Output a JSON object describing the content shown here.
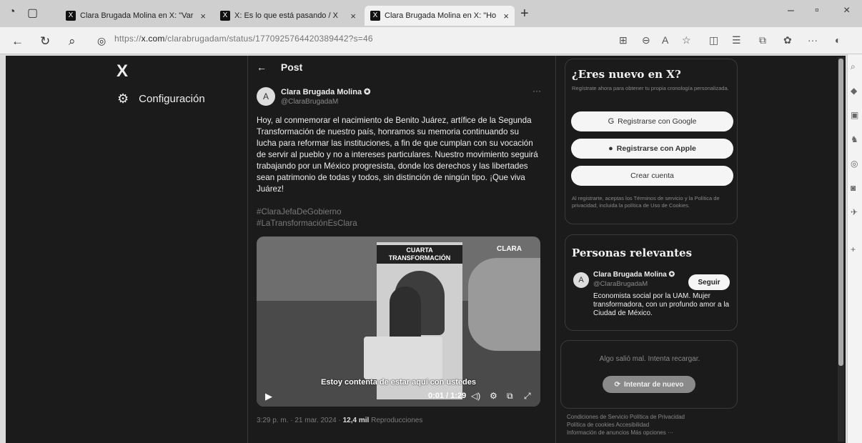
{
  "tabs": [
    {
      "label": "Clara Brugada Molina en X: \"Var",
      "active": false
    },
    {
      "label": "X: Es lo que está pasando / X",
      "active": false
    },
    {
      "label": "Clara Brugada Molina en X: \"Ho",
      "active": true
    }
  ],
  "address": {
    "prefix": "https://",
    "domain": "x.com",
    "path": "/clarabrugadam/status/1770925764420389442?s=46"
  },
  "x_nav": {
    "logo": "X",
    "config_label": "Configuración"
  },
  "post": {
    "header": "Post",
    "author_name": "Clara Brugada Molina",
    "author_handle": "@ClaraBrugadaM",
    "avatar_initial": "A",
    "text": "Hoy, al conmemorar el nacimiento de Benito Juárez, artífice de la Segunda Transformación de nuestro país, honramos su memoria continuando su lucha para reformar las instituciones, a fin de que cumplan con su vocación de servir al pueblo y no a intereses particulares. Nuestro movimiento seguirá trabajando por un México progresista, donde los derechos y las libertades sean patrimonio de todas y todos, sin distinción de ningún tipo. ¡Que viva Juárez!",
    "hashtag1": "#ClaraJefaDeGobierno",
    "hashtag2": "#LaTransformaciónEsClara",
    "media": {
      "poster_title": "CUARTA TRANSFORMACIÓN",
      "brand": "CLARA",
      "caption": "Estoy contenta de estar aquí con ustedes",
      "time": "0:01 / 1:29"
    },
    "meta_date": "3:29 p. m. · 21 mar. 2024 · ",
    "views": "12,4 mil",
    "views_label": " Reproducciones"
  },
  "signup": {
    "title": "¿Eres nuevo en X?",
    "subtitle": "Regístrate ahora para obtener tu propia cronología personalizada.",
    "google": "Registrarse con Google",
    "apple": "Registrarse con Apple",
    "create": "Crear cuenta",
    "legal": "Al registrarte, aceptas los Términos de servicio y la Política de privacidad, incluida la política de Uso de Cookies."
  },
  "relevant": {
    "title": "Personas relevantes",
    "name": "Clara Brugada Molina",
    "handle": "@ClaraBrugadaM",
    "follow": "Seguir",
    "bio": "Economista social por la UAM. Mujer transformadora, con un profundo amor a la Ciudad de México."
  },
  "error": {
    "text": "Algo salió mal. Intenta recargar.",
    "retry": "Intentar de nuevo"
  },
  "footer": {
    "line1": "Condiciones de Servicio  Política de Privacidad",
    "line2": "Política de cookies  Accesibilidad",
    "line3": "Información de anuncios  Más opciones ···"
  }
}
